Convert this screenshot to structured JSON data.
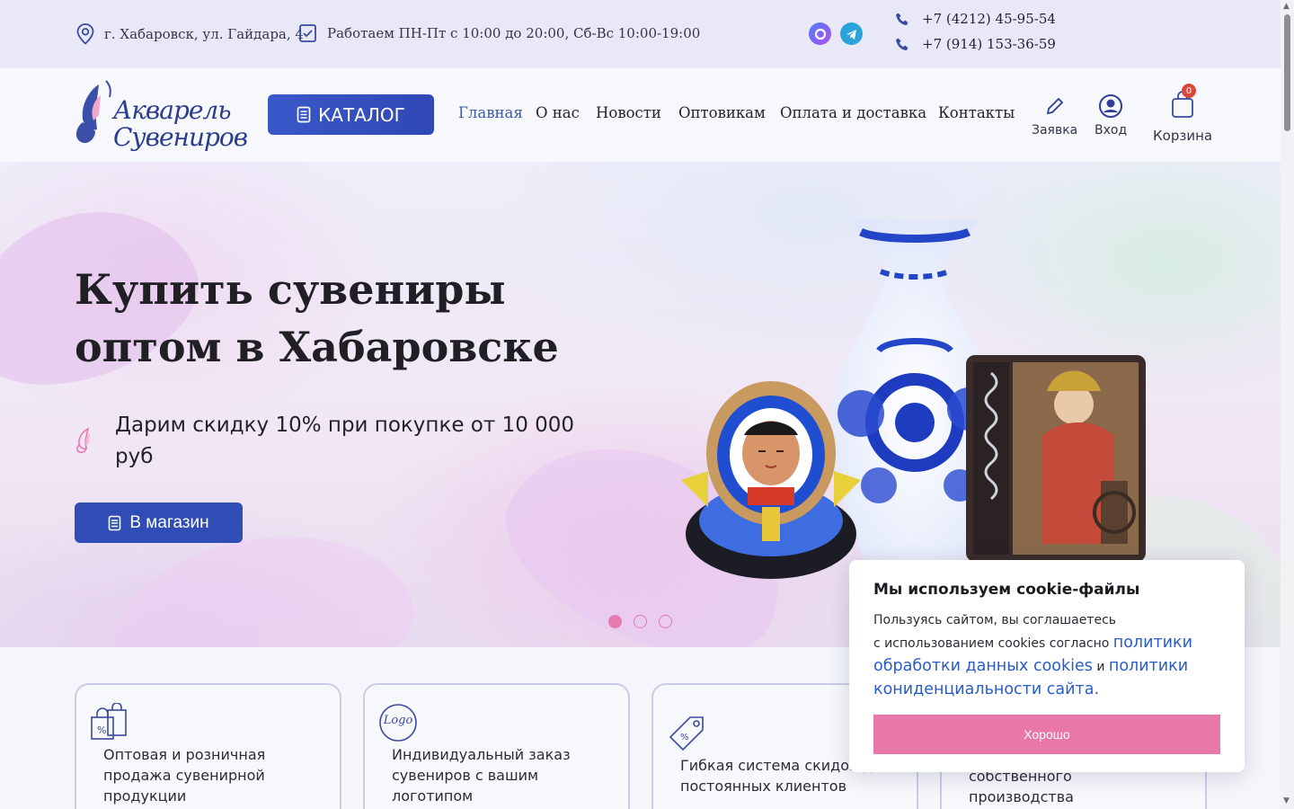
{
  "topbar": {
    "address": "г. Хабаровск, ул. Гайдара, 4",
    "hours": "Работаем ПН-Пт с 10:00 до 20:00, Сб-Вс 10:00-19:00",
    "phones": [
      "+7 (4212) 45-95-54",
      "+7 (914) 153-36-59"
    ]
  },
  "header": {
    "logo_line1": "Акварель",
    "logo_line2": "Сувениров",
    "catalog_label": "КАТАЛОГ",
    "nav": [
      "Главная",
      "О нас",
      "Новости",
      "Оптовикам",
      "Оплата и доставка",
      "Контакты"
    ],
    "request_label": "Заявка",
    "login_label": "Вход",
    "cart_label": "Корзина",
    "cart_count": "0"
  },
  "hero": {
    "title": "Купить сувениры оптом в Хабаровске",
    "subtitle": "Дарим скидку 10% при покупке от 10 000 руб",
    "button_label": "В магазин",
    "slides": 3,
    "active_slide": 1
  },
  "features": [
    {
      "text": "Оптовая и розничная продажа сувенирной продукции",
      "icon": "shopping-bags-icon"
    },
    {
      "text": "Индивидуальный заказ сувениров с вашим логотипом",
      "icon": "logo-icon",
      "icon_text": "Logo"
    },
    {
      "text": "Гибкая система скидок для постоянных клиентов",
      "icon": "discount-tag-icon"
    },
    {
      "text": "собственного производства",
      "icon": "production-icon"
    }
  ],
  "cookie": {
    "title": "Мы используем cookie-файлы",
    "line1": "Пользуясь сайтом, вы соглашаетесь",
    "line2": "с использованием cookies согласно",
    "link1": "политики обработки данных cookies",
    "and": "и",
    "link2": "политики кониденциальности сайта.",
    "ok_label": "Хорошо"
  },
  "colors": {
    "accent": "#2f4db5",
    "pink": "#e877aa",
    "topbar": "#e9e8f6"
  }
}
